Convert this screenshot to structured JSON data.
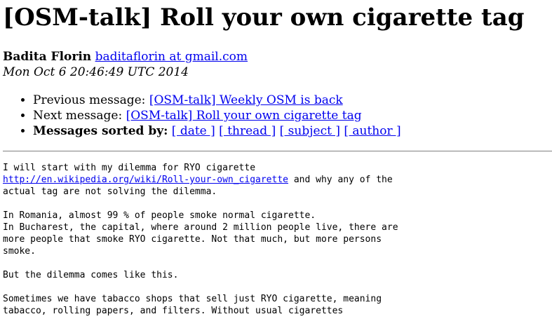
{
  "title": "[OSM-talk] Roll your own cigarette tag",
  "author": {
    "name": "Badita Florin",
    "email": "baditaflorin at gmail.com",
    "date": "Mon Oct 6 20:46:49 UTC 2014"
  },
  "nav": {
    "previous_label": "Previous message:",
    "previous_link": "[OSM-talk] Weekly OSM is back",
    "next_label": "Next message:",
    "next_link": "[OSM-talk] Roll your own cigarette tag",
    "sorted_label": "Messages sorted by:",
    "sort_date": "[ date ]",
    "sort_thread": "[ thread ]",
    "sort_subject": "[ subject ]",
    "sort_author": "[ author ]"
  },
  "body": {
    "line1": "I will start with my dilemma for RYO cigarette",
    "link": "http://en.wikipedia.org/wiki/Roll-your-own_cigarette",
    "line2_rest": " and why any of the",
    "line3": "actual tag are not solving the dilemma.",
    "para2_line1": "In Romania, almost 99 % of people smoke normal cigarette.",
    "para2_line2": "In Bucharest, the capital, where around 2 million people live, there are",
    "para2_line3": "more people that smoke RYO cigarette. Not that much, but more persons",
    "para2_line4": "smoke.",
    "para3": "But the dilemma comes like this.",
    "para4_line1": "Sometimes we have tabacco shops that sell just RYO cigarette, meaning",
    "para4_line2": "tabacco, rolling papers, and filters. Without usual cigarettes"
  }
}
